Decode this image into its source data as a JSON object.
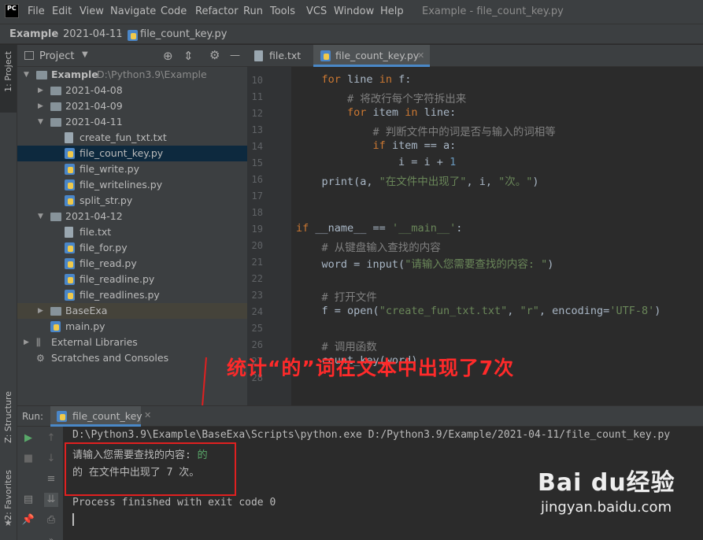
{
  "menubar": {
    "logo": "PC",
    "items": [
      "File",
      "Edit",
      "View",
      "Navigate",
      "Code",
      "Refactor",
      "Run",
      "Tools",
      "VCS",
      "Window",
      "Help"
    ],
    "window_title": "Example - file_count_key.py"
  },
  "breadcrumb": [
    "Example",
    "2021-04-11",
    "file_count_key.py"
  ],
  "left_toolstrip": {
    "project": "1: Project",
    "structure": "Z: Structure",
    "favorites": "2: Favorites"
  },
  "project_panel": {
    "title": "Project",
    "root_name": "Example",
    "root_path": "D:\\Python3.9\\Example",
    "tree": [
      {
        "label": "2021-04-08",
        "type": "folder",
        "depth": 1,
        "state": "collapsed"
      },
      {
        "label": "2021-04-09",
        "type": "folder",
        "depth": 1,
        "state": "collapsed"
      },
      {
        "label": "2021-04-11",
        "type": "folder",
        "depth": 1,
        "state": "expanded"
      },
      {
        "label": "create_fun_txt.txt",
        "type": "txt",
        "depth": 2
      },
      {
        "label": "file_count_key.py",
        "type": "py",
        "depth": 2,
        "selected": true
      },
      {
        "label": "file_write.py",
        "type": "py",
        "depth": 2
      },
      {
        "label": "file_writelines.py",
        "type": "py",
        "depth": 2
      },
      {
        "label": "split_str.py",
        "type": "py",
        "depth": 2
      },
      {
        "label": "2021-04-12",
        "type": "folder",
        "depth": 1,
        "state": "expanded"
      },
      {
        "label": "file.txt",
        "type": "txt",
        "depth": 2
      },
      {
        "label": "file_for.py",
        "type": "py",
        "depth": 2
      },
      {
        "label": "file_read.py",
        "type": "py",
        "depth": 2
      },
      {
        "label": "file_readline.py",
        "type": "py",
        "depth": 2
      },
      {
        "label": "file_readlines.py",
        "type": "py",
        "depth": 2
      },
      {
        "label": "BaseExa",
        "type": "folder",
        "depth": 1,
        "state": "collapsed",
        "highlight": true
      },
      {
        "label": "main.py",
        "type": "py",
        "depth": 1
      },
      {
        "label": "External Libraries",
        "type": "lib",
        "depth": 0,
        "state": "collapsed"
      },
      {
        "label": "Scratches and Consoles",
        "type": "scratch",
        "depth": 0
      }
    ]
  },
  "editor_tabs": [
    {
      "label": "file.txt",
      "active": false
    },
    {
      "label": "file_count_key.py",
      "active": true
    }
  ],
  "code_lines": [
    {
      "n": "10",
      "text": "    for line in f:"
    },
    {
      "n": "11",
      "text": "        # 将改行每个字符拆出来"
    },
    {
      "n": "12",
      "text": "        for item in line:"
    },
    {
      "n": "13",
      "text": "            # 判断文件中的词是否与输入的词相等"
    },
    {
      "n": "14",
      "text": "            if item == a:"
    },
    {
      "n": "15",
      "text": "                i = i + 1"
    },
    {
      "n": "16",
      "text": "    print(a, \"在文件中出现了\", i, \"次。\")"
    },
    {
      "n": "17",
      "text": ""
    },
    {
      "n": "18",
      "text": ""
    },
    {
      "n": "19",
      "text": "if __name__ == '__main__':"
    },
    {
      "n": "20",
      "text": "    # 从键盘输入查找的内容"
    },
    {
      "n": "21",
      "text": "    word = input(\"请输入您需要查找的内容: \")"
    },
    {
      "n": "22",
      "text": ""
    },
    {
      "n": "23",
      "text": "    # 打开文件"
    },
    {
      "n": "24",
      "text": "    f = open(\"create_fun_txt.txt\", \"r\", encoding='UTF-8')"
    },
    {
      "n": "25",
      "text": ""
    },
    {
      "n": "26",
      "text": "    # 调用函数"
    },
    {
      "n": "27",
      "text": "    count_key(word)"
    },
    {
      "n": "28",
      "text": ""
    }
  ],
  "run_panel": {
    "label": "Run:",
    "tab": "file_count_key",
    "output": [
      "D:\\Python3.9\\Example\\BaseExa\\Scripts\\python.exe D:/Python3.9/Example/2021-04-11/file_count_key.py",
      "请输入您需要查找的内容: ",
      "的 在文件中出现了 7 次。",
      "",
      "Process finished with exit code 0"
    ],
    "user_input": "的"
  },
  "annotation": "统计“的”词在文本中出现了7次",
  "watermark": {
    "brand": "Bai du经验",
    "url": "jingyan.baidu.com"
  },
  "colors": {
    "keyword": "#cc7832",
    "string": "#6a8759",
    "comment": "#808080",
    "number": "#6897bb",
    "annotation": "#ff2a2a"
  }
}
